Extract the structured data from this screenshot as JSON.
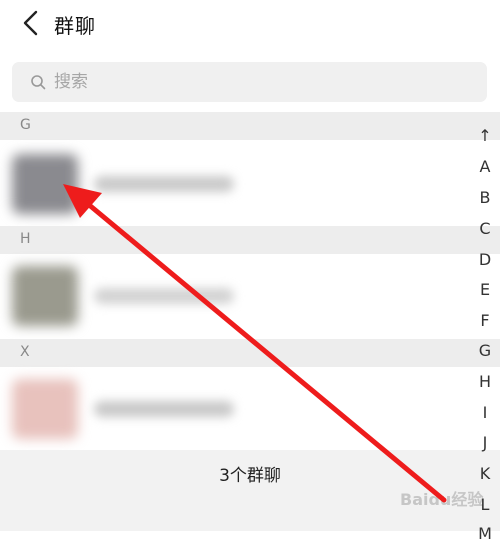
{
  "header": {
    "title": "群聊",
    "back_icon": "chevron-left-icon"
  },
  "search": {
    "placeholder": "搜索",
    "icon": "search-icon"
  },
  "sections": [
    {
      "letter": "G",
      "items": [
        {
          "name": ""
        }
      ]
    },
    {
      "letter": "H",
      "items": [
        {
          "name": ""
        }
      ]
    },
    {
      "letter": "X",
      "items": [
        {
          "name": ""
        }
      ]
    }
  ],
  "index_bar": [
    "↑",
    "A",
    "B",
    "C",
    "D",
    "E",
    "F",
    "G",
    "H",
    "I",
    "J",
    "K",
    "L",
    "M"
  ],
  "footer": {
    "count_text": "3个群聊"
  },
  "watermark": "Baidu经验",
  "annotation": {
    "color": "#ee1c1c"
  }
}
